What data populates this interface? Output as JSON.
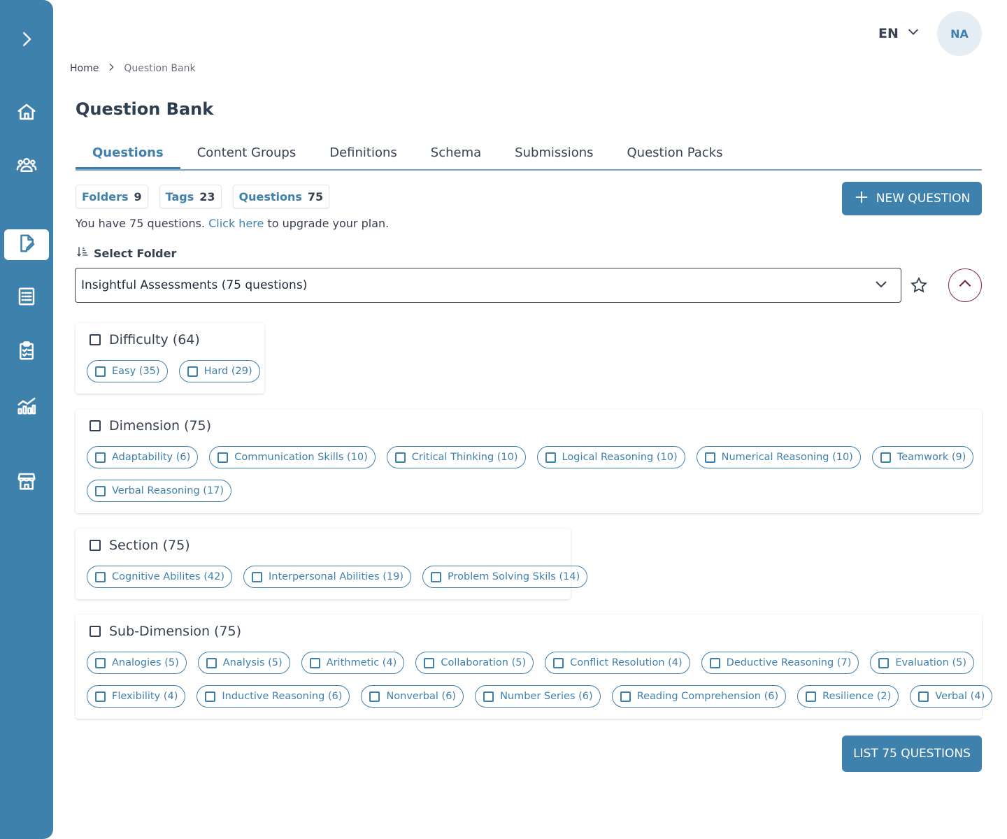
{
  "sidebar": {
    "toggle_icon": "chevron-right-icon",
    "items": [
      {
        "name": "home",
        "icon": "home-icon"
      },
      {
        "name": "users",
        "icon": "users-icon"
      },
      {
        "name": "question-bank",
        "icon": "edit-document-icon",
        "active": true
      },
      {
        "name": "list",
        "icon": "list-icon"
      },
      {
        "name": "clipboard",
        "icon": "clipboard-check-icon"
      },
      {
        "name": "analytics",
        "icon": "chart-icon"
      },
      {
        "name": "store",
        "icon": "store-icon"
      }
    ]
  },
  "topbar": {
    "language": "EN",
    "avatar_initials": "NA"
  },
  "breadcrumb": {
    "home": "Home",
    "current": "Question Bank"
  },
  "page_title": "Question Bank",
  "tabs": [
    "Questions",
    "Content Groups",
    "Definitions",
    "Schema",
    "Submissions",
    "Question Packs"
  ],
  "active_tab": "Questions",
  "counters": {
    "folders_label": "Folders",
    "folders_value": "9",
    "tags_label": "Tags",
    "tags_value": "23",
    "questions_label": "Questions",
    "questions_value": "75"
  },
  "new_question_label": "NEW QUESTION",
  "plan_note": {
    "before": "You have 75 questions.",
    "link": "Click here",
    "after": "to upgrade your plan."
  },
  "select_folder_label": "Select Folder",
  "folder_select_value": "Insightful Assessments (75 questions)",
  "groups": {
    "difficulty": {
      "title": "Difficulty (64)",
      "chips": [
        "Easy (35)",
        "Hard (29)"
      ]
    },
    "dimension": {
      "title": "Dimension (75)",
      "chips_row1": [
        "Adaptability (6)",
        "Communication Skills (10)",
        "Critical Thinking (10)",
        "Logical Reasoning (10)",
        "Numerical Reasoning (10)",
        "Teamwork (9)"
      ],
      "chips_row2": [
        "Verbal Reasoning (17)"
      ]
    },
    "section": {
      "title": "Section (75)",
      "chips": [
        "Cognitive Abilites (42)",
        "Interpersonal Abilities (19)",
        "Problem Solving Skils (14)"
      ]
    },
    "subdimension": {
      "title": "Sub-Dimension (75)",
      "chips_row1": [
        "Analogies (5)",
        "Analysis (5)",
        "Arithmetic (4)",
        "Collaboration (5)",
        "Conflict Resolution (4)",
        "Deductive Reasoning (7)",
        "Evaluation (5)"
      ],
      "chips_row2": [
        "Flexibility (4)",
        "Inductive Reasoning (6)",
        "Nonverbal (6)",
        "Number Series (6)",
        "Reading Comprehension (6)",
        "Resilience (2)",
        "Verbal (4)"
      ]
    }
  },
  "list_button_label": "LIST 75 QUESTIONS",
  "colors": {
    "primary": "#3f81ad",
    "accent_border": "#7b2a3b",
    "text": "#374151"
  }
}
